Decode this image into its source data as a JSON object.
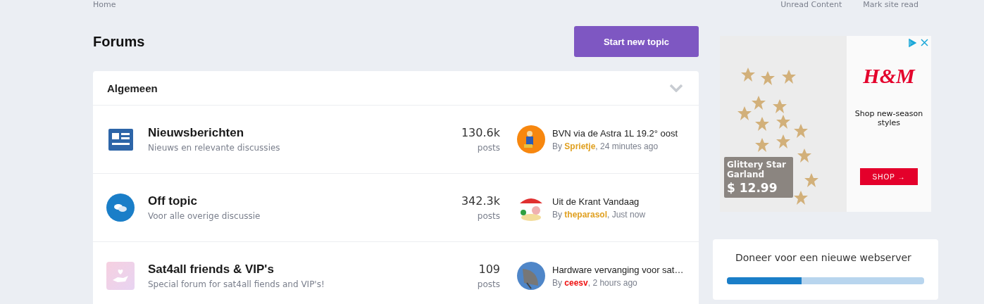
{
  "top_nav": {
    "breadcrumb": "Home",
    "links": [
      "Unread Content",
      "Mark site read"
    ]
  },
  "page_title": "Forums",
  "start_button": "Start new topic",
  "category": {
    "title": "Algemeen",
    "expanded": true
  },
  "forums": [
    {
      "kind": "news",
      "title": "Nieuwsberichten",
      "description": "Nieuws en relevante discussies",
      "count": "130.6k",
      "count_label": "posts",
      "last_title": "BVN via de Astra 1L 19.2° oost",
      "by": "By",
      "author": "Sprietje",
      "color": "#e0a020",
      "time": ", 24 minutes ago"
    },
    {
      "kind": "chat",
      "title": "Off topic",
      "description": "Voor alle overige discussie",
      "count": "342.3k",
      "count_label": "posts",
      "last_title": "Uit de Krant Vandaag",
      "by": "By",
      "author": "theparasol",
      "color": "#e0a020",
      "time": ", Just now"
    },
    {
      "kind": "heart",
      "title": "Sat4all friends & VIP's",
      "description": "Special forum for sat4all fiends and VIP's!",
      "count": "109",
      "count_label": "posts",
      "last_title": "Hardware vervanging voor sat…",
      "by": "By",
      "author": "ceesv",
      "color": "#ee1111",
      "time": ", 2 hours ago"
    }
  ],
  "ad": {
    "caption": "Glittery Star Garland",
    "price": "$ 12.99",
    "brand": "H&M",
    "tagline": "Shop new-season styles",
    "cta": "SHOP →"
  },
  "donation": {
    "title": "Doneer voor een nieuwe webserver",
    "level": 0.38
  }
}
